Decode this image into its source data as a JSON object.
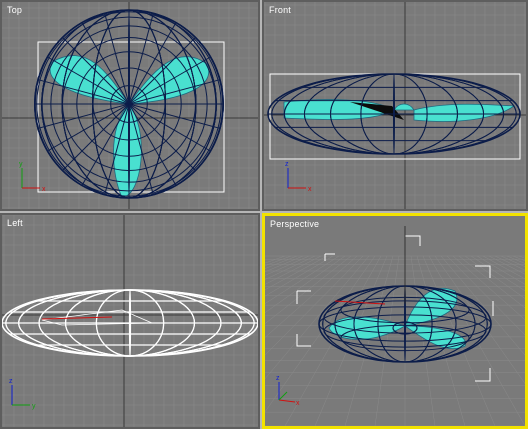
{
  "viewports": {
    "top": {
      "label": "Top"
    },
    "front": {
      "label": "Front"
    },
    "left": {
      "label": "Left"
    },
    "perspective": {
      "label": "Perspective"
    }
  },
  "axes": {
    "x": "x",
    "y": "y",
    "z": "z"
  },
  "colors": {
    "viewport_bg": "#7a7a7a",
    "grid": "#8a8a8a",
    "grid_major": "#3b3b3b",
    "wire_selected": "#0c1d4a",
    "wire_unselected": "#ffffff",
    "fill": "#49e0d0",
    "active_border": "#f2e200",
    "axis_x": "#d01010",
    "axis_y": "#10a010",
    "axis_z": "#1020d0"
  }
}
